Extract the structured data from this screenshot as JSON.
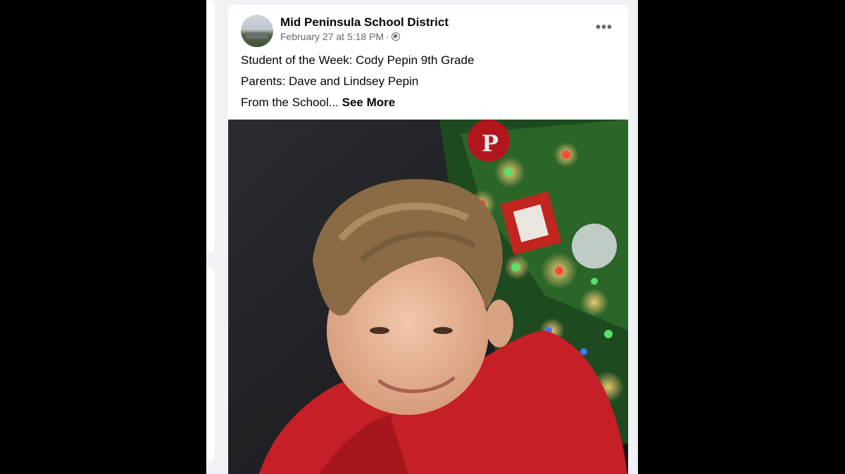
{
  "post": {
    "author": "Mid Peninsula School District",
    "timestamp": "February 27 at 5:18 PM",
    "separator": "·",
    "privacy_icon": "globe-icon",
    "more_icon": "more-options-icon",
    "more_label": "•••",
    "lines": [
      "Student of the Week:  Cody Pepin 9th Grade",
      "Parents: Dave and Lindsey Pepin"
    ],
    "truncated_line": "From the School...",
    "see_more_label": "See More"
  },
  "colors": {
    "page_background": "#000000",
    "feed_background": "#f0f2f5",
    "card_background": "#ffffff",
    "primary_text": "#050505",
    "secondary_text": "#65676b"
  }
}
